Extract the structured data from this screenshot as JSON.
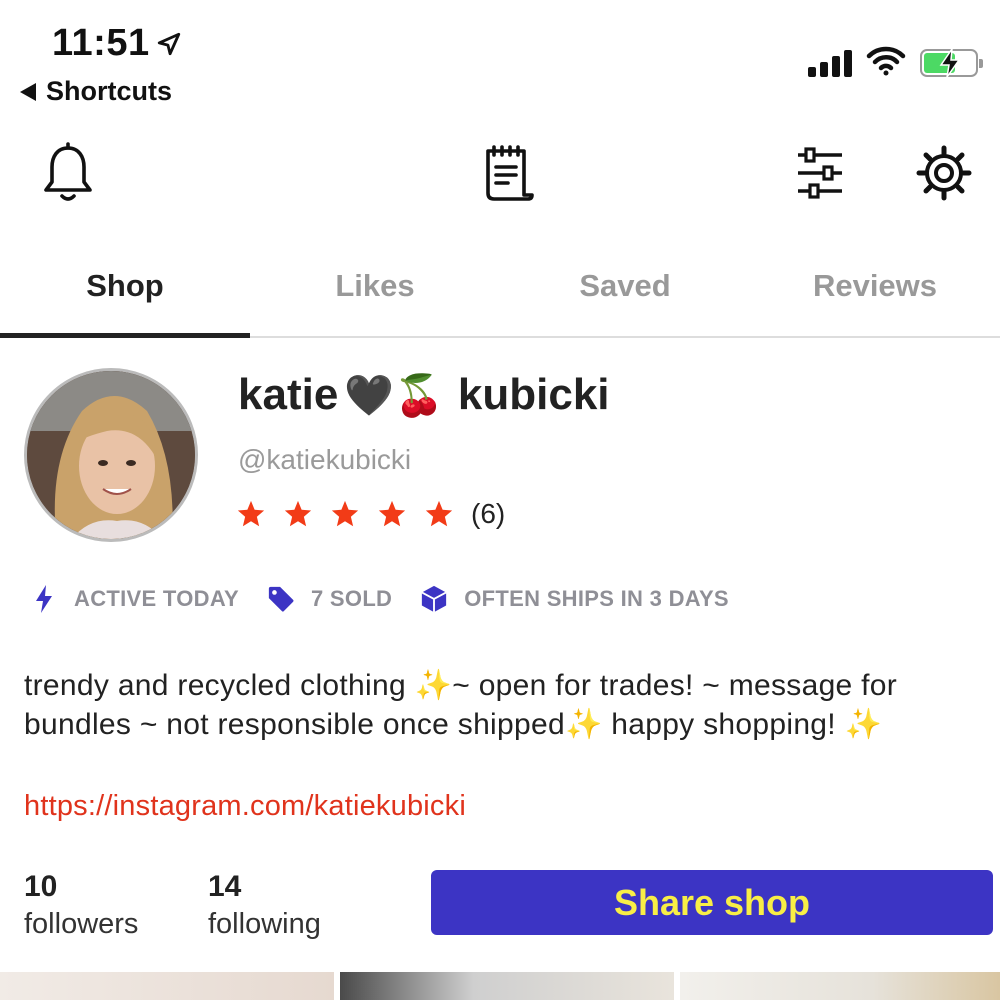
{
  "status_bar": {
    "time": "11:51",
    "back_label": "Shortcuts"
  },
  "toolbar": {
    "icons": [
      "bell-icon",
      "receipt-icon",
      "sliders-icon",
      "gear-icon"
    ]
  },
  "tabs": [
    {
      "label": "Shop",
      "active": true
    },
    {
      "label": "Likes",
      "active": false
    },
    {
      "label": "Saved",
      "active": false
    },
    {
      "label": "Reviews",
      "active": false
    }
  ],
  "profile": {
    "name_first": "katie",
    "name_emoji": "🖤🍒",
    "name_last": "kubicki",
    "handle": "@katiekubicki",
    "rating_stars": 5,
    "review_count": "(6)"
  },
  "badges": [
    {
      "icon": "lightning-icon",
      "label": "ACTIVE TODAY"
    },
    {
      "icon": "tag-icon",
      "label": "7 SOLD"
    },
    {
      "icon": "box-icon",
      "label": "OFTEN SHIPS IN 3 DAYS"
    }
  ],
  "bio": {
    "text": "trendy and recycled clothing ✨~ open for trades! ~ message for bundles ~ not responsible once shipped✨ happy shopping! ✨",
    "link": "https://instagram.com/katiekubicki"
  },
  "stats": {
    "followers_count": "10",
    "followers_label": "followers",
    "following_count": "14",
    "following_label": "following"
  },
  "share_button": {
    "label": "Share shop"
  },
  "colors": {
    "accent_button": "#3c34c4",
    "button_text": "#f8ee46",
    "star": "#f23b17",
    "link": "#e0331c",
    "badge_icon": "#3c34c4"
  }
}
